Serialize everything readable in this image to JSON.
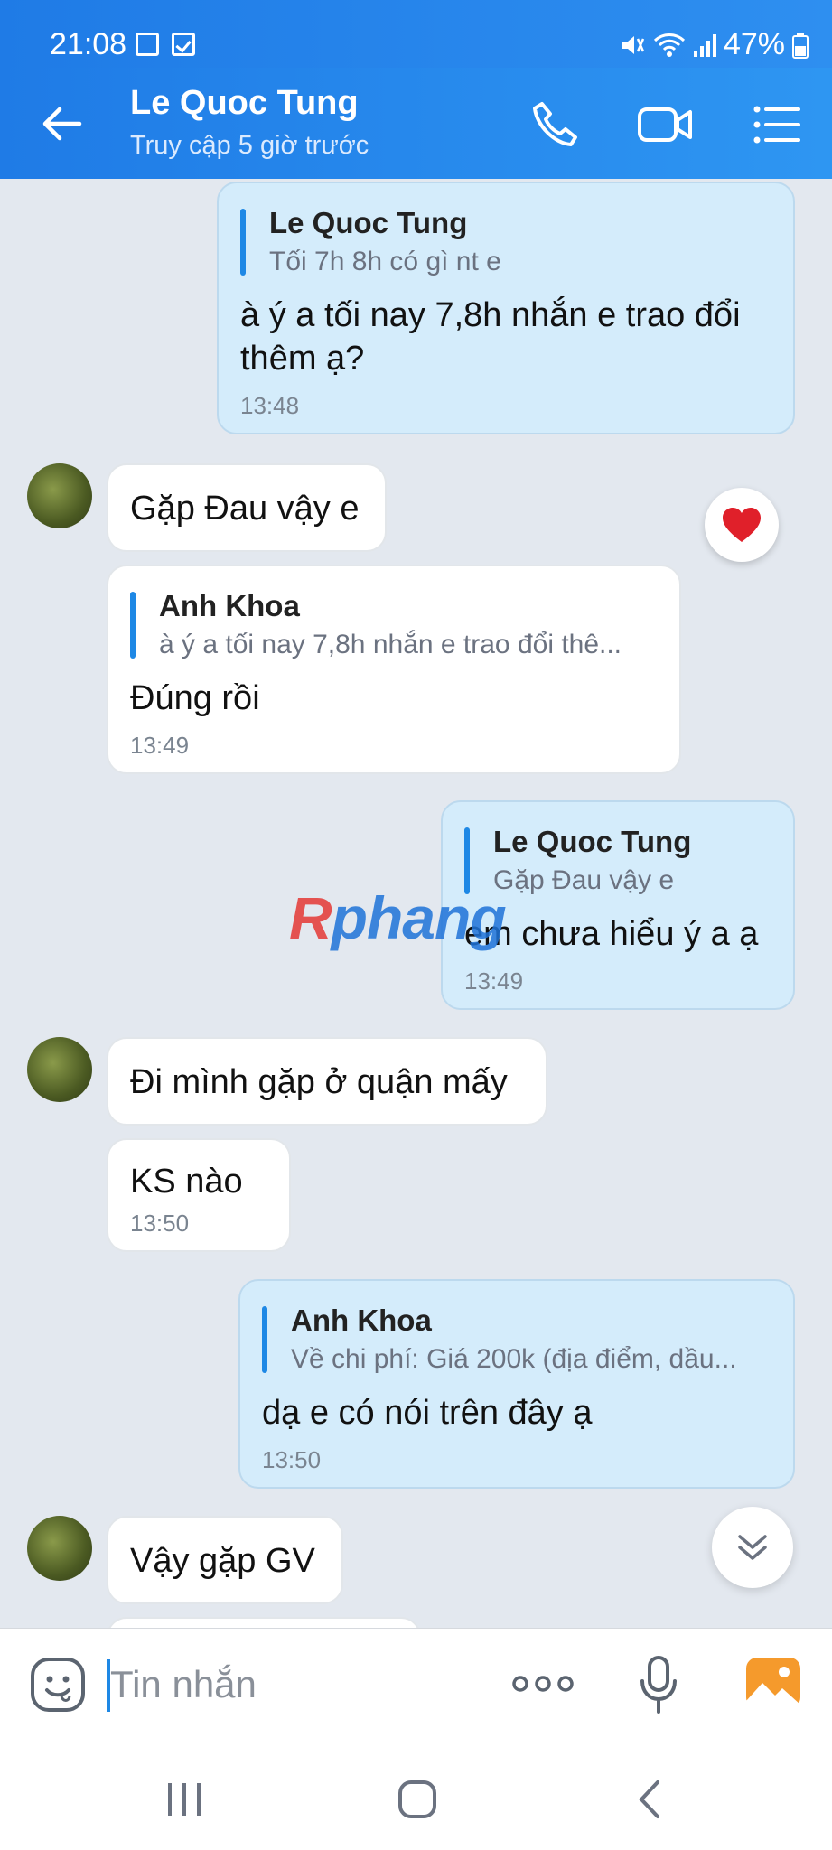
{
  "status_bar": {
    "time": "21:08",
    "battery": "47%"
  },
  "header": {
    "contact_name": "Le Quoc Tung",
    "last_seen": "Truy cập 5 giờ trước"
  },
  "messages": [
    {
      "quote_name": "Le Quoc Tung",
      "quote_text": "Tối 7h 8h có gì nt e",
      "text_line1": "à ý a tối nay 7,8h nhắn e trao đổi",
      "text_line2": "thêm ạ?",
      "time": "13:48"
    },
    {
      "text": "Gặp Đau vậy e"
    },
    {
      "quote_name": "Anh Khoa",
      "quote_text": "à ý a tối nay 7,8h nhắn e trao đổi thê...",
      "text": "Đúng rồi",
      "time": "13:49"
    },
    {
      "quote_name": "Le Quoc Tung",
      "quote_text": "Gặp Đau vậy e",
      "text": "em chưa hiểu ý a ạ",
      "time": "13:49"
    },
    {
      "text": "Đi mình gặp ở quận mấy"
    },
    {
      "text": "KS nào",
      "time": "13:50"
    },
    {
      "quote_name": "Anh Khoa",
      "quote_text": "Về chi phí: Giá 200k (địa điểm, dầu...",
      "text": "dạ e có nói trên đây ạ",
      "time": "13:50"
    },
    {
      "text": "Vậy gặp GV"
    }
  ],
  "watermark": {
    "first": "R",
    "rest": "phang"
  },
  "input": {
    "placeholder": "Tin nhắn"
  },
  "colors": {
    "header": "#1f7be6",
    "outgoing_bubble": "#d4ecfb",
    "incoming_bubble": "#ffffff",
    "background": "#e3e8ef",
    "quote_bar": "#1e88e5"
  }
}
